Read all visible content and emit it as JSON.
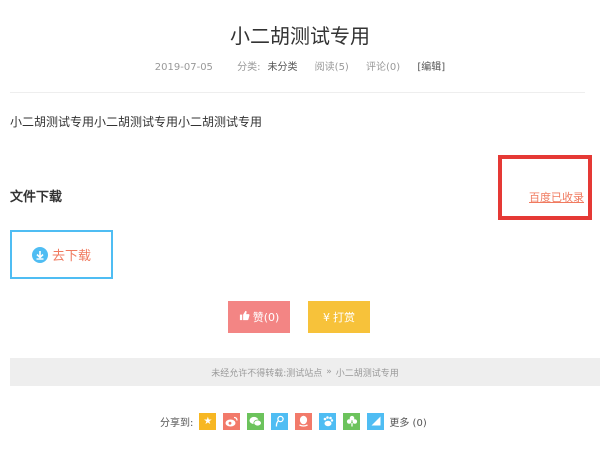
{
  "post": {
    "title": "小二胡测试专用",
    "date": "2019-07-05",
    "category_label": "分类:",
    "category_value": "未分类",
    "reads": "阅读(5)",
    "comments": "评论(0)",
    "edit": "[编辑]",
    "content": "小二胡测试专用小二胡测试专用小二胡测试专用"
  },
  "download": {
    "section_title": "文件下载",
    "button_label": "去下载",
    "baidu_status": "百度已收录"
  },
  "actions": {
    "like_label": "赞(0)",
    "reward_label": "打赏"
  },
  "copyright": {
    "notice": "未经允许不得转载:",
    "site": "测试站点",
    "separator": "»",
    "post_title": "小二胡测试专用"
  },
  "share": {
    "label": "分享到:",
    "more": "更多 (0)",
    "icons": [
      "qzone-icon",
      "weibo-icon",
      "wechat-icon",
      "tencent-weibo-icon",
      "qq-icon",
      "baidu-icon",
      "renren-icon",
      "bookmark-icon"
    ]
  },
  "colors": {
    "accent_red": "#e53935",
    "link_orange": "#f07a5f",
    "download_border": "#4fbdf3",
    "like_bg": "#f38584",
    "reward_bg": "#f7c23a"
  }
}
